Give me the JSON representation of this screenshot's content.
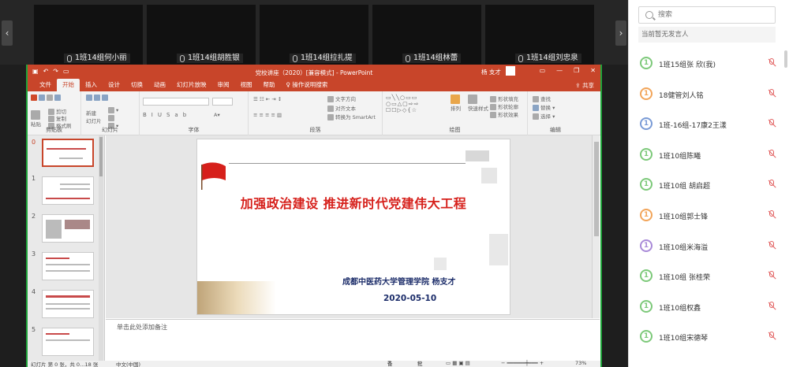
{
  "video_strip": {
    "tiles": [
      {
        "label": "1班14组何小丽"
      },
      {
        "label": "1班14组胡胜银"
      },
      {
        "label": "1班14组拉扎提"
      },
      {
        "label": "1班14组林蕾"
      },
      {
        "label": "1班14组刘忠泉"
      }
    ],
    "prev_icon": "chevron-left-icon",
    "next_icon": "chevron-right-icon"
  },
  "ppt": {
    "window_title": "党校讲座（2020）[兼容模式] - PowerPoint",
    "user_name": "杨 支才",
    "tabs": [
      "文件",
      "开始",
      "插入",
      "设计",
      "切换",
      "动画",
      "幻灯片放映",
      "审阅",
      "视图",
      "帮助",
      "操作说明搜索"
    ],
    "active_tab": "开始",
    "share_label": "共享",
    "ribbon": {
      "paste": "粘贴",
      "cut_copy": [
        "剪切",
        "复制",
        "格式刷"
      ],
      "new_slide": "新建\n幻灯片",
      "text_direction": "文字方向",
      "align_text": "对齐文本",
      "smartart": "转换为 SmartArt",
      "arrange": "排列",
      "quick_styles": "快速样式",
      "shape_fill": "形状填充",
      "shape_outline": "形状轮廓",
      "shape_effects": "形状效果",
      "find": "查找",
      "replace": "替换",
      "select": "选择",
      "groups": [
        "剪贴板",
        "幻灯片",
        "字体",
        "段落",
        "绘图",
        "编辑"
      ]
    },
    "thumbnails": [
      "0",
      "1",
      "2",
      "3",
      "4",
      "5"
    ],
    "slide": {
      "title": "加强政治建设  推进新时代党建伟大工程",
      "org": "成都中医药大学管理学院    杨支才",
      "date": "2020-05-10"
    },
    "notes_placeholder": "单击此处添加备注",
    "status": {
      "slide_info": "幻灯片 第 0 张，共 0…18 张",
      "language": "中文(中国)",
      "notes": "备注",
      "comments": "批注",
      "zoom": "73%"
    }
  },
  "panel": {
    "search_placeholder": "搜索",
    "no_speaker": "当前暂无发言人",
    "attendees": [
      {
        "name": "1班15组张 欣(我)",
        "color": "#7dc97a"
      },
      {
        "name": "18健管刘人铭",
        "color": "#f2a55a"
      },
      {
        "name": "1班-16组-17康2王漾",
        "color": "#7a9bd6"
      },
      {
        "name": "1班10组陈曦",
        "color": "#7dc97a"
      },
      {
        "name": "1班10组 胡启超",
        "color": "#7dc97a"
      },
      {
        "name": "1班10组郭士锋",
        "color": "#f2a55a"
      },
      {
        "name": "1班10组米海溢",
        "color": "#a98ad8"
      },
      {
        "name": "1班10组 张桂荣",
        "color": "#7dc97a"
      },
      {
        "name": "1班10组权鑫",
        "color": "#7dc97a"
      },
      {
        "name": "1班10组宋德琴",
        "color": "#7dc97a"
      }
    ],
    "attendee_number": "1",
    "mute_icon": "mic-muted-icon"
  }
}
